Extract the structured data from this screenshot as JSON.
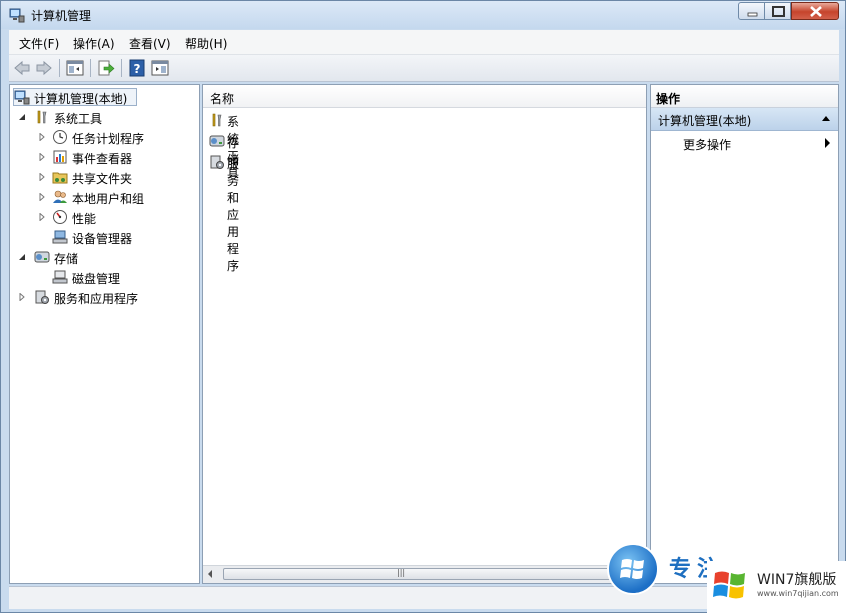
{
  "window": {
    "title": "计算机管理",
    "controls": {
      "minimize": "minimize-icon",
      "maximize": "maximize-icon",
      "close": "close-icon"
    }
  },
  "menu": {
    "items": [
      "文件(F)",
      "操作(A)",
      "查看(V)",
      "帮助(H)"
    ]
  },
  "toolbar": {
    "buttons": [
      "back-arrow-icon",
      "forward-arrow-icon",
      "show-hide-console-tree-icon",
      "export-list-icon",
      "help-icon",
      "show-hide-action-pane-icon"
    ]
  },
  "tree": {
    "root": "计算机管理(本地)",
    "items": [
      {
        "label": "系统工具",
        "level": 1,
        "expanded": true
      },
      {
        "label": "任务计划程序",
        "level": 2,
        "expander": "collapsed"
      },
      {
        "label": "事件查看器",
        "level": 2,
        "expander": "collapsed"
      },
      {
        "label": "共享文件夹",
        "level": 2,
        "expander": "collapsed"
      },
      {
        "label": "本地用户和组",
        "level": 2,
        "expander": "collapsed"
      },
      {
        "label": "性能",
        "level": 2,
        "expander": "collapsed"
      },
      {
        "label": "设备管理器",
        "level": 2,
        "expander": "none"
      },
      {
        "label": "存储",
        "level": 1,
        "expanded": true
      },
      {
        "label": "磁盘管理",
        "level": 2,
        "expander": "none"
      },
      {
        "label": "服务和应用程序",
        "level": 1,
        "expander": "collapsed"
      }
    ]
  },
  "list": {
    "column_header": "名称",
    "rows": [
      "系统工具",
      "存储",
      "服务和应用程序"
    ]
  },
  "actions": {
    "header": "操作",
    "section": "计算机管理(本地)",
    "item": "更多操作"
  },
  "watermark": {
    "brand": "WIN7旗舰版",
    "url": "www.win7qijian.com",
    "partial_text": "专注"
  }
}
